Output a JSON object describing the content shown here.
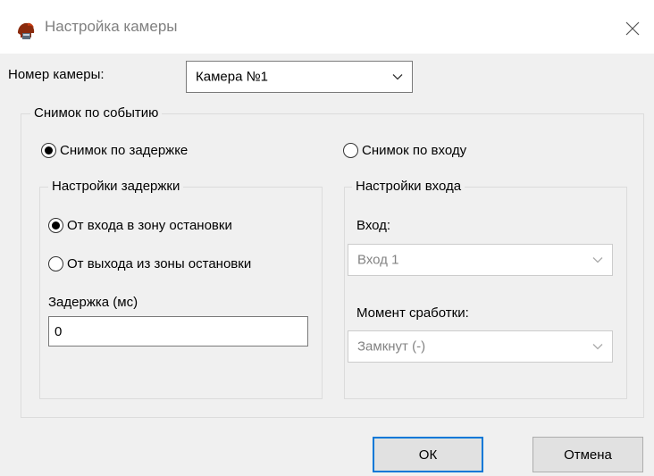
{
  "window": {
    "title": "Настройка камеры"
  },
  "camera": {
    "label": "Номер камеры:",
    "selected": "Камера №1"
  },
  "event_group": {
    "title": "Снимок по событию",
    "radio_delay": "Снимок по задержке",
    "radio_input": "Снимок по входу",
    "mode": "delay"
  },
  "delay_settings": {
    "title": "Настройки задержки",
    "radio_enter": "От входа в зону остановки",
    "radio_exit": "От выхода из зоны остановки",
    "delay_label": "Задержка (мс)",
    "delay_value": "0"
  },
  "input_settings": {
    "title": "Настройки входа",
    "input_label": "Вход:",
    "input_value": "Вход 1",
    "moment_label": "Момент сработки:",
    "moment_value": "Замкнут (-)"
  },
  "buttons": {
    "ok": "ОК",
    "cancel": "Отмена"
  },
  "icons": {
    "app": "helmet-icon",
    "close": "close-icon",
    "dropdown": "chevron-down-icon"
  }
}
